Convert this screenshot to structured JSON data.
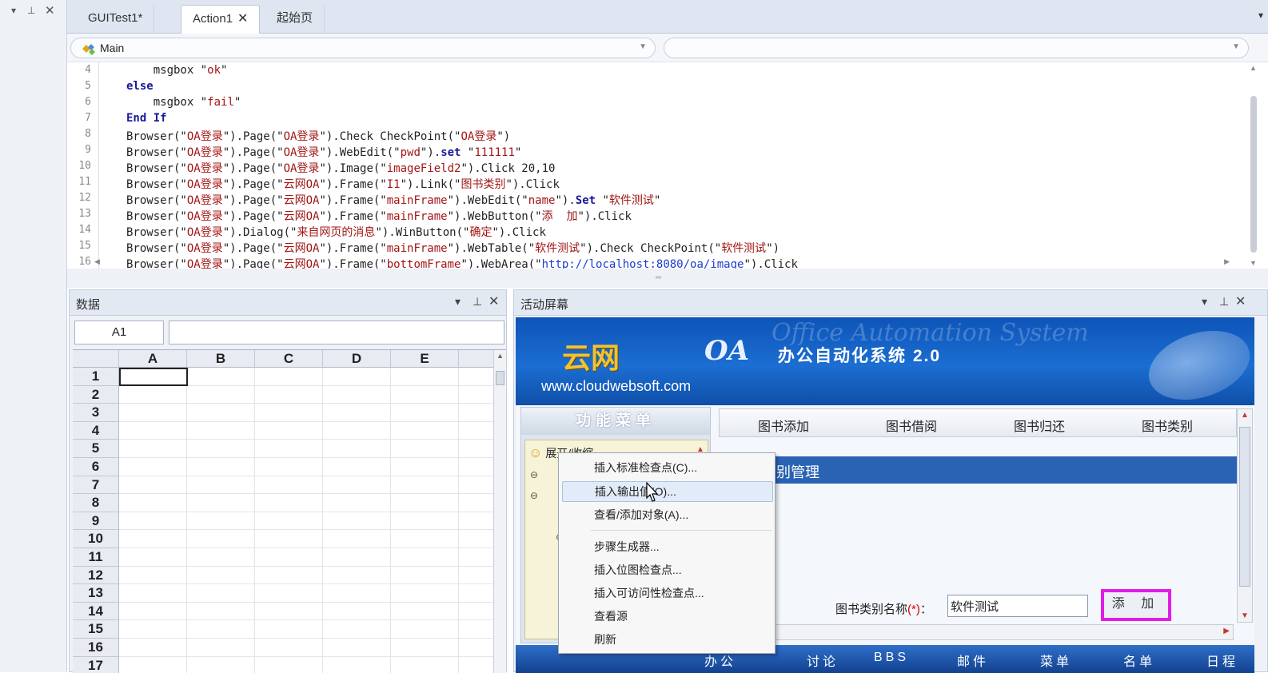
{
  "tabs": [
    {
      "label": "GUITest1*"
    },
    {
      "label": "Action1"
    },
    {
      "label": "起始页"
    }
  ],
  "dropdowns": {
    "left": "Main",
    "right": ""
  },
  "code": {
    "line_numbers": [
      "4",
      "5",
      "6",
      "7",
      "8",
      "9",
      "10",
      "11",
      "12",
      "13",
      "14",
      "15",
      "16"
    ],
    "lines": [
      "    msgbox \"ok\"",
      "else",
      "    msgbox \"fail\"",
      "End If",
      "Browser(\"OA登录\").Page(\"OA登录\").Check CheckPoint(\"OA登录\")",
      "Browser(\"OA登录\").Page(\"OA登录\").WebEdit(\"pwd\").set \"111111\"",
      "Browser(\"OA登录\").Page(\"OA登录\").Image(\"imageField2\").Click 20,10",
      "Browser(\"OA登录\").Page(\"云网OA\").Frame(\"I1\").Link(\"图书类别\").Click",
      "Browser(\"OA登录\").Page(\"云网OA\").Frame(\"mainFrame\").WebEdit(\"name\").Set \"软件测试\"",
      "Browser(\"OA登录\").Page(\"云网OA\").Frame(\"mainFrame\").WebButton(\"添  加\").Click",
      "Browser(\"OA登录\").Dialog(\"来自网页的消息\").WinButton(\"确定\").Click",
      "Browser(\"OA登录\").Page(\"云网OA\").Frame(\"mainFrame\").WebTable(\"软件测试\").Check CheckPoint(\"软件测试\")",
      "Browser(\"OA登录\").Page(\"云网OA\").Frame(\"bottomFrame\").WebArea(\"http://localhost:8080/oa/image\").Click"
    ]
  },
  "data_panel": {
    "title": "数据",
    "cell_ref": "A1",
    "formula": "",
    "columns": [
      "A",
      "B",
      "C",
      "D",
      "E"
    ],
    "rows": [
      "1",
      "2",
      "3",
      "4",
      "5",
      "6",
      "7",
      "8",
      "9",
      "10",
      "11",
      "12",
      "13",
      "14",
      "15",
      "16",
      "17"
    ]
  },
  "active_panel": {
    "title": "活动屏幕",
    "oa": {
      "brand": "云网",
      "product": "OA",
      "subtitle": "办公自动化系统 2.0",
      "url": "www.cloudwebsoft.com",
      "ghost_text": "Office Automation System",
      "func_menu_title": "功能菜单",
      "tree_first": "展开/收缩",
      "nav": [
        "图书添加",
        "图书借阅",
        "图书归还",
        "图书类别"
      ],
      "mgmt_title": "别管理",
      "form_label": "图书类别名称",
      "form_required": "(*)",
      "form_value": "软件测试",
      "add_button": "添 加",
      "bottom_items": [
        "办公",
        "讨论",
        "BBS",
        "邮件",
        "菜单",
        "名单",
        "日程"
      ]
    }
  },
  "context_menu": {
    "items": [
      "插入标准检查点(C)...",
      "插入输出值(O)...",
      "查看/添加对象(A)...",
      "步骤生成器...",
      "插入位图检查点...",
      "插入可访问性检查点...",
      "查看源",
      "刷新"
    ],
    "highlighted": "插入输出值(O)..."
  },
  "colors": {
    "accent_blue": "#2b63b4",
    "highlight_magenta": "#e01ce6",
    "keyword": "#1a1a9a",
    "string": "#a31515"
  }
}
